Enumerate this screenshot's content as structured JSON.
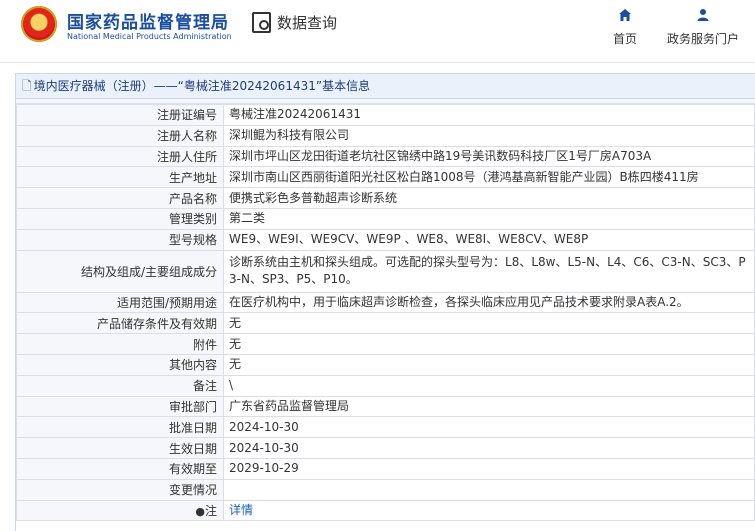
{
  "header": {
    "brand_cn": "国家药品监督管理局",
    "brand_en": "National Medical Products Administration",
    "data_query": "数据查询",
    "nav_home": "首页",
    "nav_portal": "政务服务门户"
  },
  "panel": {
    "title": "境内医疗器械（注册）——“粤械注准20242061431”基本信息"
  },
  "rows": [
    {
      "label": "注册证编号",
      "value": "粤械注准20242061431"
    },
    {
      "label": "注册人名称",
      "value": "深圳鲲为科技有限公司"
    },
    {
      "label": "注册人住所",
      "value": "深圳市坪山区龙田街道老坑社区锦绣中路19号美讯数码科技厂区1号厂房A703A"
    },
    {
      "label": "生产地址",
      "value": "深圳市南山区西丽街道阳光社区松白路1008号（港鸿基高新智能产业园）B栋四楼411房"
    },
    {
      "label": "产品名称",
      "value": "便携式彩色多普勒超声诊断系统"
    },
    {
      "label": "管理类别",
      "value": "第二类"
    },
    {
      "label": "型号规格",
      "value": "WE9、WE9I、WE9CV、WE9P 、WE8、WE8I、WE8CV、WE8P"
    },
    {
      "label": "结构及组成/主要组成成分",
      "value": "诊断系统由主机和探头组成。可选配的探头型号为：L8、L8w、L5-N、L4、C6、C3-N、SC3、P3-N、SP3、P5、P10。"
    },
    {
      "label": "适用范围/预期用途",
      "value": "在医疗机构中，用于临床超声诊断检查，各探头临床应用见产品技术要求附录A表A.2。"
    },
    {
      "label": "产品储存条件及有效期",
      "value": "无"
    },
    {
      "label": "附件",
      "value": "无"
    },
    {
      "label": "其他内容",
      "value": "无"
    },
    {
      "label": "备注",
      "value": "\\"
    },
    {
      "label": "审批部门",
      "value": "广东省药品监督管理局"
    },
    {
      "label": "批准日期",
      "value": "2024-10-30"
    },
    {
      "label": "生效日期",
      "value": "2024-10-30"
    },
    {
      "label": "有效期至",
      "value": "2029-10-29"
    },
    {
      "label": "变更情况",
      "value": ""
    },
    {
      "label": "注",
      "value": "详情"
    }
  ],
  "colors": {
    "brand": "#1b4ea0",
    "link": "#1b61c0",
    "label_bg": "#f5f7fa"
  },
  "icons": {
    "home": "home-icon",
    "user": "user-icon",
    "data_query": "data-query-icon",
    "note": "pin-icon"
  }
}
